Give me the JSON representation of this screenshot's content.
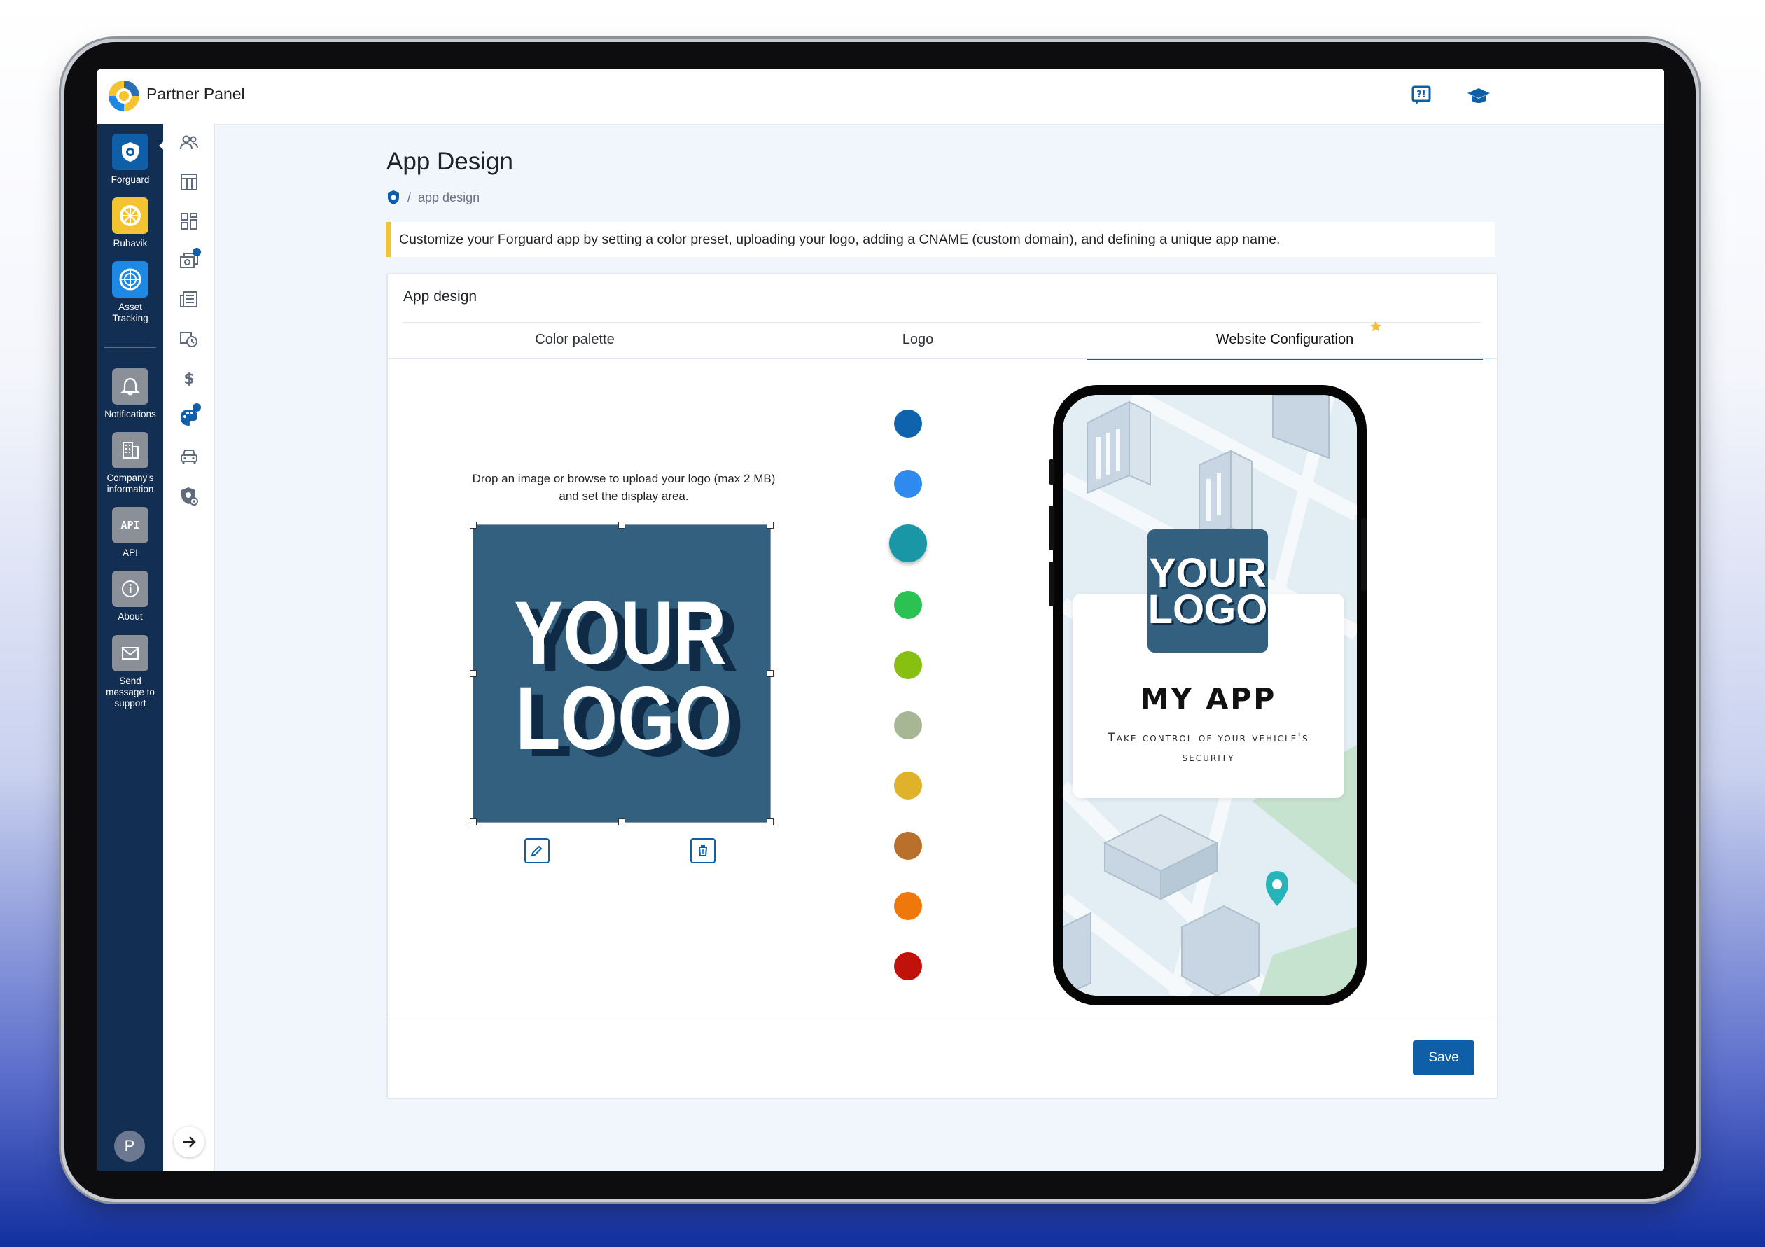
{
  "app": {
    "title": "Partner Panel"
  },
  "sidebar": {
    "items": [
      {
        "label": "Forguard",
        "icon": "shield-icon",
        "color": "#0f5fa8"
      },
      {
        "label": "Ruhavik",
        "icon": "ruhavik-logo-icon",
        "color": "#f4c430"
      },
      {
        "label": "Asset Tracking",
        "icon": "asset-tracking-icon",
        "color": "#1e88e5"
      },
      {
        "label": "Notifications",
        "icon": "bell-icon",
        "color": "#8a8f98"
      },
      {
        "label": "Company's information",
        "icon": "building-icon",
        "color": "#8a8f98"
      },
      {
        "label": "API",
        "icon": "api-icon",
        "color": "#8a8f98"
      },
      {
        "label": "About",
        "icon": "info-icon",
        "color": "#8a8f98"
      },
      {
        "label": "Send message to support",
        "icon": "mail-icon",
        "color": "#8a8f98"
      }
    ],
    "avatar": "P"
  },
  "rail": {
    "icons": [
      "users-icon",
      "calculator-icon",
      "dashboard-icon",
      "camera-gallery-icon",
      "news-icon",
      "history-icon",
      "dollar-icon",
      "palette-icon",
      "car-icon",
      "shield-eye-icon"
    ]
  },
  "page": {
    "title": "App Design",
    "breadcrumb": "app design",
    "info": "Customize your Forguard app by setting a color preset, uploading your logo, adding a CNAME (custom domain), and defining a unique app name."
  },
  "card": {
    "title": "App design",
    "tabs": [
      "Color palette",
      "Logo",
      "Website Configuration"
    ],
    "active_tab": "Website Configuration",
    "upload_hint": "Drop an image or browse to upload your logo (max 2 MB) and set the display area.",
    "logo_text": [
      "YOUR",
      "LOGO"
    ],
    "swatches": [
      "#0f63ad",
      "#2f8af0",
      "#1a97a6",
      "#2bc153",
      "#87c010",
      "#a7b795",
      "#e0b12b",
      "#b9702a",
      "#ee780c",
      "#c0120a"
    ],
    "selected_swatch": "#1a97a6",
    "save_label": "Save"
  },
  "preview": {
    "app_name": "MY APP",
    "tagline": "Take control of your vehicle's security"
  }
}
